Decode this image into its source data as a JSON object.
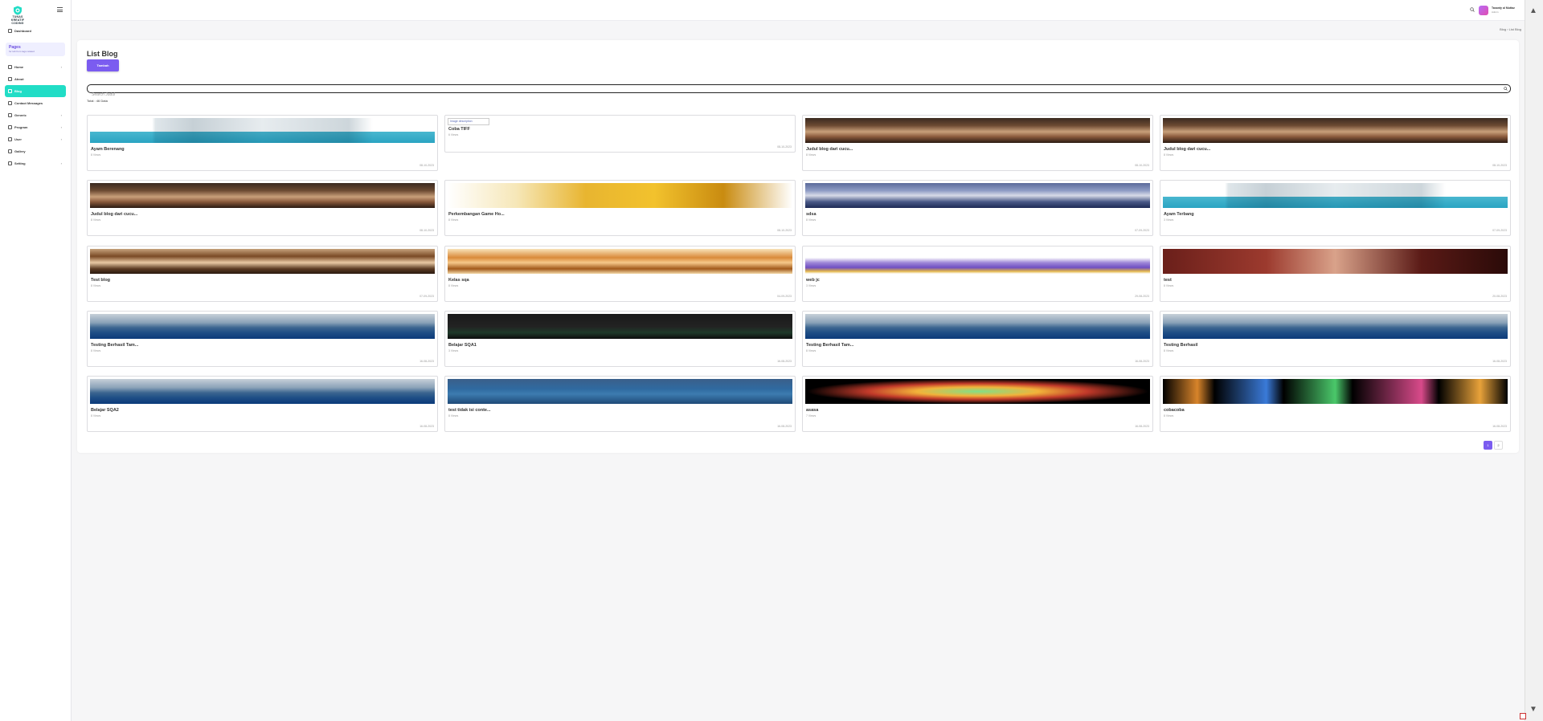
{
  "brand": {
    "line1": "TUNAS",
    "line2": "KREATIF",
    "line3": "CODING"
  },
  "sidebar": {
    "dashboard": "Dashboard",
    "pages_title": "Pages",
    "pages_sub": "for tab from tags related",
    "items": [
      {
        "label": "Home",
        "icon": "home-icon",
        "chevron": true
      },
      {
        "label": "About",
        "icon": "info-icon",
        "chevron": false
      },
      {
        "label": "Blog",
        "icon": "blog-icon",
        "chevron": false,
        "active": true
      },
      {
        "label": "Contact Messages",
        "icon": "mail-icon",
        "chevron": false
      },
      {
        "label": "Generic",
        "icon": "grid-icon",
        "chevron": true
      },
      {
        "label": "Program",
        "icon": "program-icon",
        "chevron": true
      },
      {
        "label": "User",
        "icon": "user-icon",
        "chevron": true
      },
      {
        "label": "Gallery",
        "icon": "gallery-icon",
        "chevron": false
      },
      {
        "label": "Setting",
        "icon": "gear-icon",
        "chevron": true
      }
    ]
  },
  "header": {
    "user_name": "Tasanty al Muttaz",
    "user_role": "Admin"
  },
  "breadcrumb": "Blog  ›  List Blog",
  "page": {
    "title": "List Blog",
    "add_label": "Tambah",
    "search_placeholder": "Search Judul",
    "total_text": "Total : 46 Data"
  },
  "posts": [
    {
      "title": "Ayam Berenang",
      "views": "8 Views",
      "date": "08-10-2023",
      "img": "a"
    },
    {
      "title": "Coba TIFF",
      "views": "6 Views",
      "date": "08-10-2023",
      "img": "broken",
      "alt": "Image description"
    },
    {
      "title": "Judul blog dari cucu...",
      "views": "8 Views",
      "date": "08-10-2023",
      "img": "b"
    },
    {
      "title": "Judul blog dari cucu...",
      "views": "8 Views",
      "date": "08-10-2023",
      "img": "b"
    },
    {
      "title": "Judul blog dari cucu...",
      "views": "8 Views",
      "date": "08-10-2023",
      "img": "b"
    },
    {
      "title": "Perkembangan Game Ho...",
      "views": "8 Views",
      "date": "08-10-2023",
      "img": "c"
    },
    {
      "title": "sdsa",
      "views": "8 Views",
      "date": "07-09-2023",
      "img": "d"
    },
    {
      "title": "Ayam Terbang",
      "views": "3 Views",
      "date": "07-09-2023",
      "img": "a"
    },
    {
      "title": "Test blog",
      "views": "8 Views",
      "date": "07-09-2023",
      "img": "e"
    },
    {
      "title": "Kelas sqa",
      "views": "8 Views",
      "date": "04-09-2023",
      "img": "f"
    },
    {
      "title": "web jc",
      "views": "3 Views",
      "date": "29-08-2023",
      "img": "g"
    },
    {
      "title": "test",
      "views": "8 Views",
      "date": "20-08-2023",
      "img": "h"
    },
    {
      "title": "Testing Berhasil Tam...",
      "views": "8 Views",
      "date": "16-08-2023",
      "img": "i"
    },
    {
      "title": "Belajar SQA1",
      "views": "3 Views",
      "date": "16-08-2023",
      "img": "j"
    },
    {
      "title": "Testing Berhasil Tam...",
      "views": "8 Views",
      "date": "16-08-2023",
      "img": "i"
    },
    {
      "title": "Testing Berhasil",
      "views": "8 Views",
      "date": "16-08-2023",
      "img": "i"
    },
    {
      "title": "Belajar SQA2",
      "views": "8 Views",
      "date": "16-08-2023",
      "img": "i"
    },
    {
      "title": "test tidak isi conte...",
      "views": "8 Views",
      "date": "16-08-2023",
      "img": "k"
    },
    {
      "title": "asasa",
      "views": "7 Views",
      "date": "16-08-2023",
      "img": "l"
    },
    {
      "title": "cobacoba",
      "views": "8 Views",
      "date": "16-08-2023",
      "img": "m"
    }
  ],
  "pagination": [
    "1",
    "2"
  ],
  "colors": {
    "accent": "#7b5cf0",
    "active_nav": "#21ddc6"
  }
}
